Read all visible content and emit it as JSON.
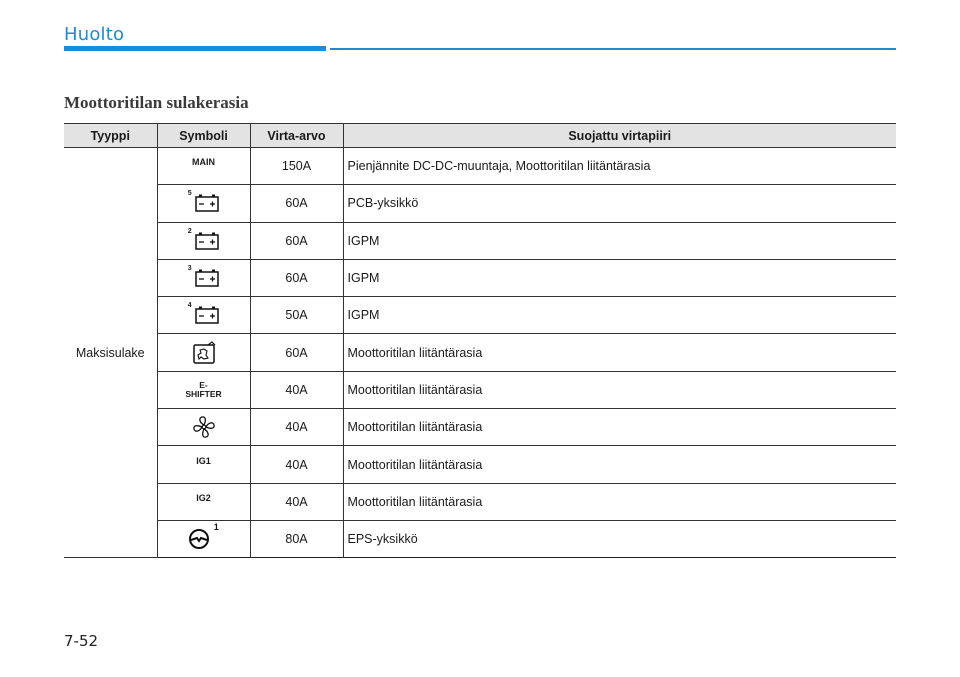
{
  "header": {
    "section": "Huolto"
  },
  "heading": "Moottoritilan sulakerasia",
  "table": {
    "columns": [
      "Tyyppi",
      "Symboli",
      "Virta-arvo",
      "Suojattu virtapiiri"
    ],
    "type_label": "Maksisulake",
    "rows": [
      {
        "symbol": "MAIN",
        "symbol_icon": "text",
        "amp": "150A",
        "circuit": "Pienjännite DC-DC-muuntaja, Moottoritilan liitäntärasia"
      },
      {
        "symbol": "5",
        "symbol_icon": "battery-icon",
        "amp": "60A",
        "circuit": "PCB-yksikkö"
      },
      {
        "symbol": "2",
        "symbol_icon": "battery-icon",
        "amp": "60A",
        "circuit": "IGPM"
      },
      {
        "symbol": "3",
        "symbol_icon": "battery-icon",
        "amp": "60A",
        "circuit": "IGPM"
      },
      {
        "symbol": "4",
        "symbol_icon": "battery-icon",
        "amp": "50A",
        "circuit": "IGPM"
      },
      {
        "symbol": "",
        "symbol_icon": "heated-glass-icon",
        "amp": "60A",
        "circuit": "Moottoritilan liitäntärasia"
      },
      {
        "symbol": "E-\nSHIFTER",
        "symbol_icon": "text",
        "amp": "40A",
        "circuit": "Moottoritilan liitäntärasia"
      },
      {
        "symbol": "",
        "symbol_icon": "fan-icon",
        "amp": "40A",
        "circuit": "Moottoritilan liitäntärasia"
      },
      {
        "symbol": "IG1",
        "symbol_icon": "text",
        "amp": "40A",
        "circuit": "Moottoritilan liitäntärasia"
      },
      {
        "symbol": "IG2",
        "symbol_icon": "text",
        "amp": "40A",
        "circuit": "Moottoritilan liitäntärasia"
      },
      {
        "symbol": "1",
        "symbol_icon": "steering-wheel-icon",
        "amp": "80A",
        "circuit": "EPS-yksikkö"
      }
    ]
  },
  "page_number": "7-52",
  "colors": {
    "accent": "#1a8ccf",
    "header_bg": "#e3e3e3"
  }
}
